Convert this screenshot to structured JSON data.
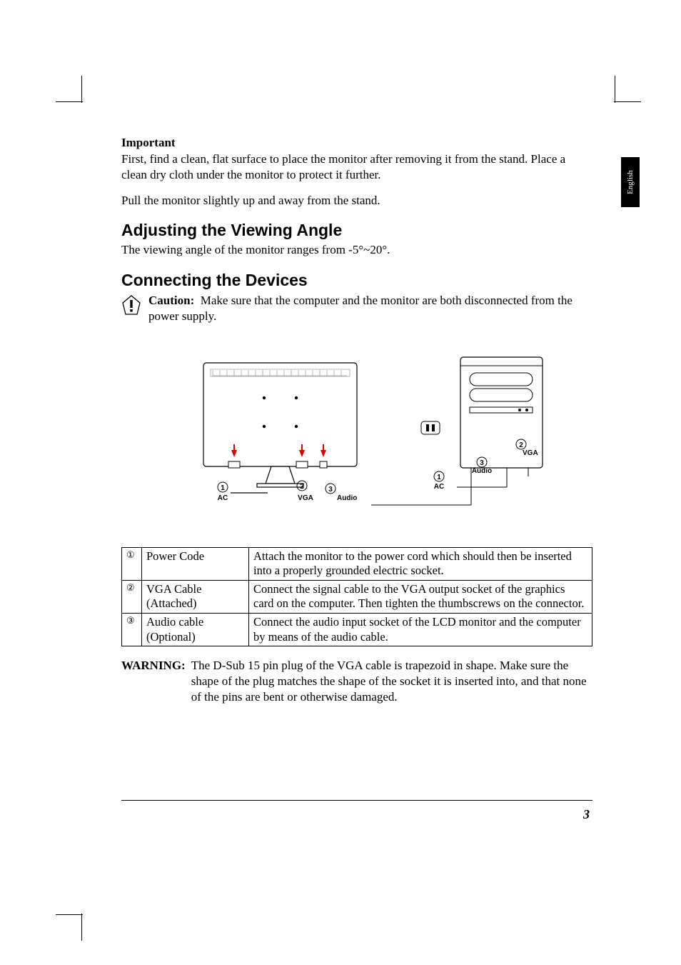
{
  "sideTab": "English",
  "importantHeading": "Important",
  "importantP1": "First, find a clean, flat surface to place the monitor after removing it from the stand. Place a clean dry cloth under the monitor to protect it further.",
  "importantP2": "Pull the monitor slightly up and away from the stand.",
  "adjustHeading": "Adjusting the Viewing Angle",
  "adjustBody": "The viewing angle of the monitor ranges from  -5°~20°.",
  "connectHeading": "Connecting the Devices",
  "cautionLabel": "Caution:",
  "cautionBody": "Make sure that the computer and the monitor are both disconnected from the power supply.",
  "diagram": {
    "acLabel": "AC",
    "vgaLabel": "VGA",
    "audioLabel": "Audio",
    "n1": "1",
    "n2": "2",
    "n3": "3"
  },
  "table": {
    "r1": {
      "num": "①",
      "label": "Power Code",
      "desc": "Attach the monitor to the power cord which should then be inserted into a properly grounded electric socket."
    },
    "r2": {
      "num": "②",
      "label1": "VGA Cable",
      "label2": "(Attached)",
      "desc": "Connect the signal cable to the VGA output socket of  the graphics card on the computer. Then tighten the thumbscrews on the connector."
    },
    "r3": {
      "num": "③",
      "label1": "Audio cable",
      "label2": "(Optional)",
      "desc": "Connect the audio input socket of the LCD monitor and the computer by means of the audio cable."
    }
  },
  "warningLabel": "WARNING:",
  "warningBody": "The D-Sub 15 pin plug of the VGA cable is trapezoid in shape. Make sure the shape of the plug matches the shape of the socket it is inserted into, and that none of the pins are bent or otherwise damaged.",
  "pageNumber": "3"
}
